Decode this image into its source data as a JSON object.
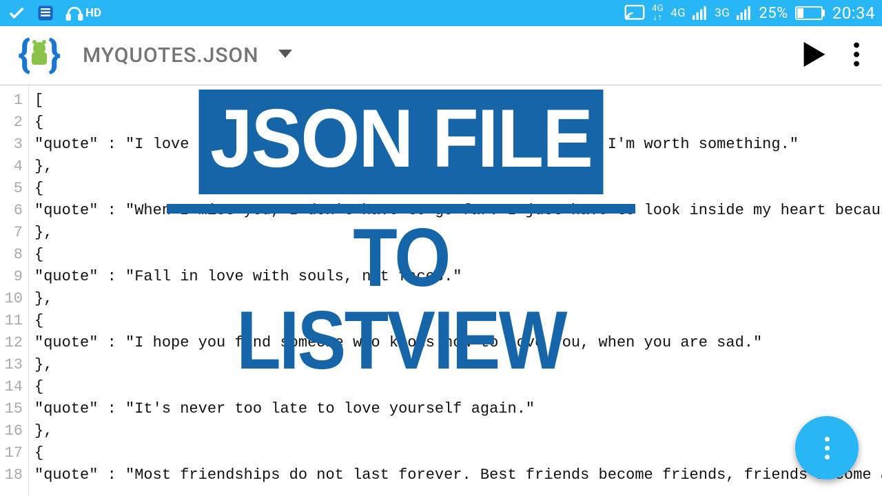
{
  "status": {
    "battery_pct": "25%",
    "clock": "20:34",
    "hd_label": "HD",
    "net1": "4G",
    "net2": "3G"
  },
  "toolbar": {
    "filename": "MYQUOTES.JSON"
  },
  "overlay": {
    "line1": "JSON FILE",
    "line2": "TO LISTVIEW"
  },
  "code": {
    "lines": [
      "[",
      "{",
      "\"quote\" : \"I love the feeling when you look at me. I feel like I'm worth something.\"",
      "},",
      "{",
      "\"quote\" : \"When I miss you, I don't have to go far. I just have to look inside my heart because that's where you are.\"",
      "},",
      "{",
      "\"quote\" : \"Fall in love with souls, not faces.\"",
      "},",
      "{",
      "\"quote\" : \"I hope you find someone who knows how to love you, when you are sad.\"",
      "},",
      "{",
      "\"quote\" : \"It's never too late to love yourself again.\"",
      "},",
      "{",
      "\"quote\" : \"Most friendships do not last forever. Best friends become friends, friends become acquaintances.\""
    ]
  }
}
